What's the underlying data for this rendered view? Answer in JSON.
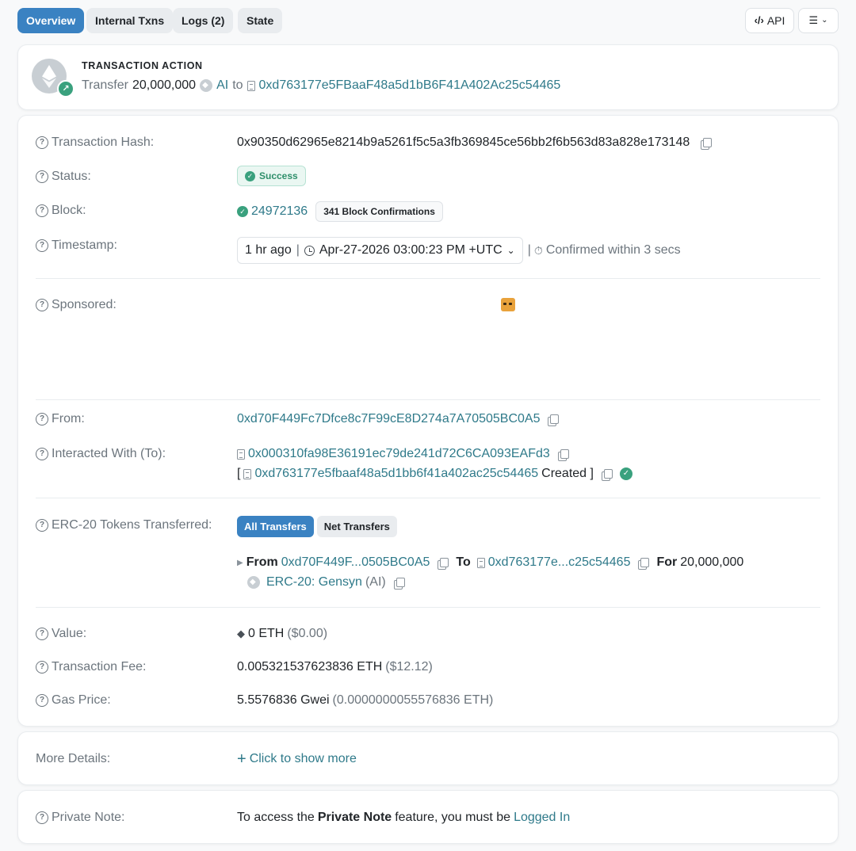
{
  "tabs": [
    {
      "label": "Overview",
      "active": true
    },
    {
      "label": "Internal Txns"
    },
    {
      "label": "Logs (2)"
    },
    {
      "label": "State"
    }
  ],
  "toolbar": {
    "api_label": "API",
    "api_icon": "code-brackets-icon",
    "list_icon": "checklist-icon"
  },
  "action": {
    "title": "TRANSACTION ACTION",
    "verb": "Transfer",
    "amount": "20,000,000",
    "token": "AI",
    "to_word": "to",
    "address": "0xd763177e5FBaaF48a5d1bB6F41A402Ac25c54465"
  },
  "details": {
    "hash_label": "Transaction Hash:",
    "hash": "0x90350d62965e8214b9a5261f5c5a3fb369845ce56bb2f6b563d83a828e173148",
    "status_label": "Status:",
    "status": "Success",
    "block_label": "Block:",
    "block": "24972136",
    "confirmations": "341 Block Confirmations",
    "timestamp_label": "Timestamp:",
    "ago": "1 hr ago",
    "datetime": "Apr-27-2026 03:00:23 PM +UTC",
    "confirmed": "Confirmed within 3 secs",
    "sponsored_label": "Sponsored:",
    "from_label": "From:",
    "from": "0xd70F449Fc7Dfce8c7F99cE8D274a7A70505BC0A5",
    "to_label": "Interacted With (To):",
    "to": "0x000310fa98E36191ec79de241d72C6CA093EAFd3",
    "created_open": "[",
    "created_addr": "0xd763177e5fbaaf48a5d1bb6f41a402ac25c54465",
    "created_word": "Created ]",
    "erc_label": "ERC-20 Tokens Transferred:",
    "all_transfers": "All Transfers",
    "net_transfers": "Net Transfers",
    "t_from_word": "From",
    "t_from": "0xd70F449F...0505BC0A5",
    "t_to_word": "To",
    "t_to": "0xd763177e...c25c54465",
    "t_for_word": "For",
    "t_amount": "20,000,000",
    "t_token": "ERC-20: Gensyn",
    "t_symbol": "(AI)",
    "value_label": "Value:",
    "value": "0 ETH",
    "value_usd": "($0.00)",
    "fee_label": "Transaction Fee:",
    "fee": "0.005321537623836 ETH",
    "fee_usd": "($12.12)",
    "gas_label": "Gas Price:",
    "gas": "5.5576836 Gwei",
    "gas_eth": "(0.0000000055576836 ETH)"
  },
  "more": {
    "label": "More Details:",
    "link": "Click to show more"
  },
  "note": {
    "label": "Private Note:",
    "pre": "To access the",
    "bold": "Private Note",
    "mid": "feature, you must be",
    "link": "Logged In"
  }
}
